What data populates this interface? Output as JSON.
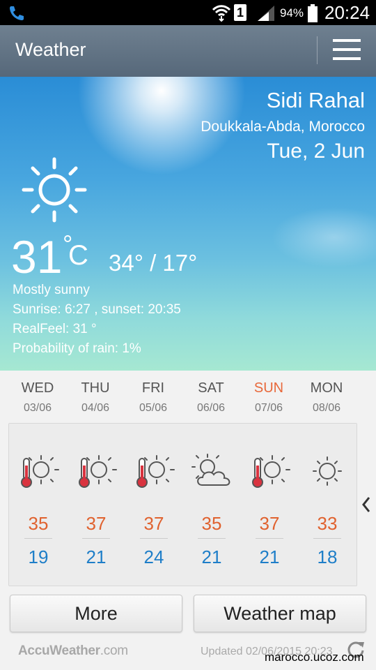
{
  "status_bar": {
    "battery_percent": "94%",
    "time": "20:24",
    "sim_slot": "1"
  },
  "app_bar": {
    "title": "Weather"
  },
  "current": {
    "city": "Sidi Rahal",
    "region": "Doukkala-Abda, Morocco",
    "date": "Tue, 2 Jun",
    "temperature": "31",
    "unit": "C",
    "degree_symbol": "°",
    "high_low": "34° / 17°",
    "condition": "Mostly sunny",
    "sun_times": "Sunrise: 6:27 , sunset: 20:35",
    "realfeel": "RealFeel: 31 °",
    "rain": "Probability of rain: 1%",
    "icon": "sun-icon"
  },
  "forecast": [
    {
      "day": "WED",
      "date": "03/06",
      "high": "35",
      "low": "19",
      "icon": "hot-sun-icon"
    },
    {
      "day": "THU",
      "date": "04/06",
      "high": "37",
      "low": "21",
      "icon": "hot-sun-icon"
    },
    {
      "day": "FRI",
      "date": "05/06",
      "high": "37",
      "low": "24",
      "icon": "hot-sun-icon"
    },
    {
      "day": "SAT",
      "date": "06/06",
      "high": "35",
      "low": "21",
      "icon": "partly-cloudy-icon"
    },
    {
      "day": "SUN",
      "date": "07/06",
      "high": "37",
      "low": "21",
      "icon": "hot-sun-icon"
    },
    {
      "day": "MON",
      "date": "08/06",
      "high": "33",
      "low": "18",
      "icon": "sun-icon"
    }
  ],
  "buttons": {
    "more": "More",
    "weather_map": "Weather map"
  },
  "footer": {
    "logo": "AccuWeather",
    "logo_suffix": ".com",
    "updated": "Updated 02/06/2015 20:23",
    "watermark": "marocco.ucoz.com"
  },
  "colors": {
    "high_temp": "#e0622f",
    "low_temp": "#1e7ec8",
    "sunday": "#e8683a"
  }
}
